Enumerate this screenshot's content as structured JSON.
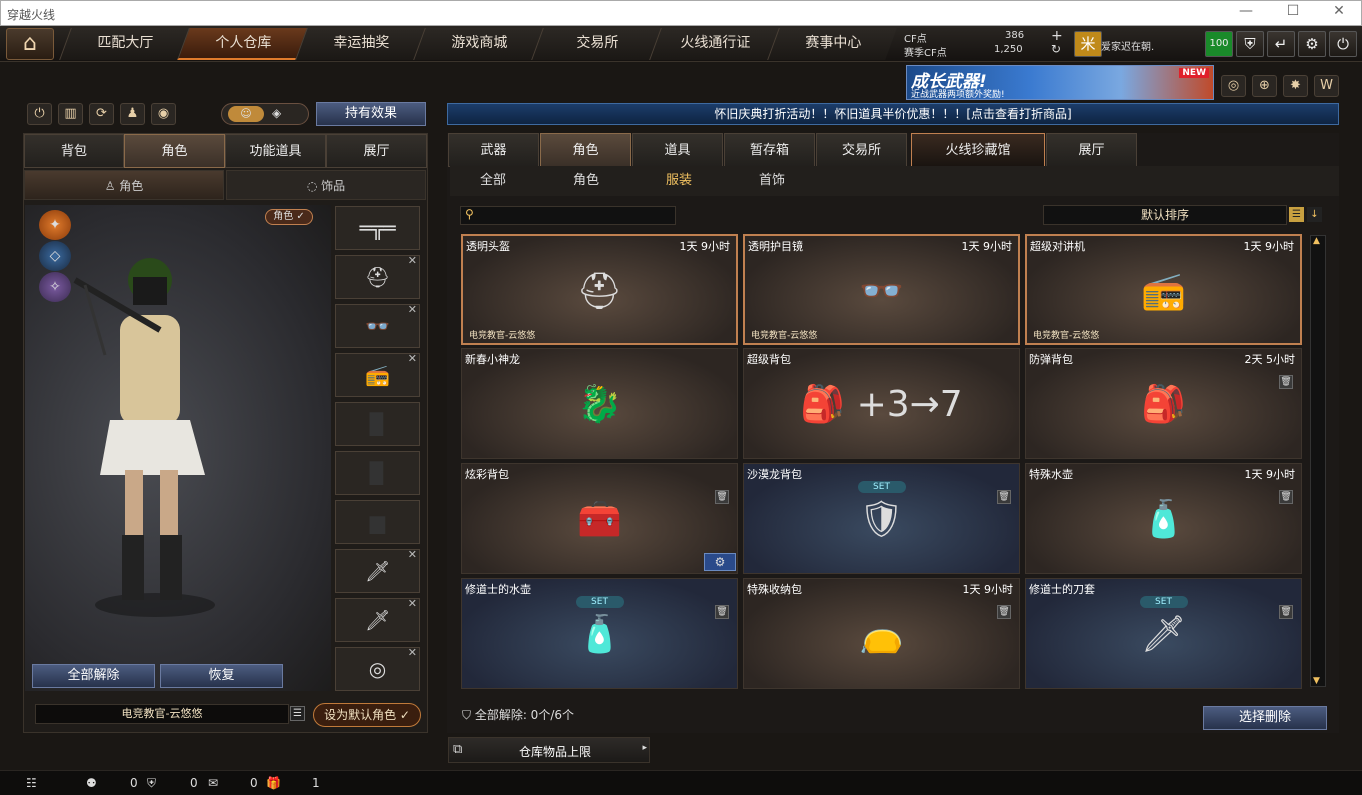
{
  "window": {
    "title": "穿越火线",
    "minimize": "—",
    "maximize": "☐",
    "close": "✕"
  },
  "nav": {
    "tabs": [
      "匹配大厅",
      "个人仓库",
      "幸运抽奖",
      "游戏商城",
      "交易所",
      "火线通行证",
      "赛事中心"
    ],
    "active": 1
  },
  "currency": {
    "cf_label": "CF点",
    "cf_value": "386",
    "match_label": "赛季CF点",
    "match_value": "1,250",
    "player": "爱家迟在朝.",
    "badge": "100",
    "icon_char": "米"
  },
  "banner": {
    "title": "成长武器!",
    "subtitle": "近战武器两项额外奖励!",
    "tag": "NEW"
  },
  "notice": "怀旧庆典打折活动！！怀旧道具半价优惠！！！[点击查看打折商品]",
  "left": {
    "effect_button": "持有效果",
    "tabs": [
      "背包",
      "角色",
      "功能道具",
      "展厅"
    ],
    "subtabs": [
      "角色",
      "饰品"
    ],
    "char_tag": "角色 ✓",
    "unequip_all": "全部解除",
    "restore": "恢复",
    "char_name": "电竞教官-云悠悠",
    "set_default": "设为默认角色 ✓"
  },
  "right": {
    "tabs": [
      "武器",
      "角色",
      "道具",
      "暂存箱",
      "交易所",
      "火线珍藏馆",
      "展厅"
    ],
    "subtabs": [
      "全部",
      "角色",
      "服装",
      "首饰"
    ],
    "sort": "默认排序",
    "unequip_status": "全部解除: 0个/6个",
    "select_delete": "选择删除",
    "storage_limit": "仓库物品上限"
  },
  "items": [
    {
      "name": "透明头盔",
      "time": "1天 9小时",
      "source": "电竞教官-云悠悠",
      "icon": "⛑",
      "selected": true
    },
    {
      "name": "透明护目镜",
      "time": "1天 9小时",
      "source": "电竞教官-云悠悠",
      "icon": "👓",
      "selected": true
    },
    {
      "name": "超级对讲机",
      "time": "1天 9小时",
      "source": "电竞教官-云悠悠",
      "icon": "📻",
      "selected": true
    },
    {
      "name": "新春小神龙",
      "time": "",
      "source": "",
      "icon": "🐉"
    },
    {
      "name": "超级背包",
      "time": "",
      "source": "",
      "icon": "🎒 +3→7"
    },
    {
      "name": "防弹背包",
      "time": "2天 5小时",
      "source": "",
      "icon": "🎒",
      "trash": true
    },
    {
      "name": "炫彩背包",
      "time": "",
      "source": "",
      "icon": "🧰",
      "trash": true,
      "gear": true
    },
    {
      "name": "沙漠龙背包",
      "time": "",
      "source": "",
      "icon": "🛡",
      "trash": true,
      "set": "SET",
      "blue": true
    },
    {
      "name": "特殊水壶",
      "time": "1天 9小时",
      "source": "",
      "icon": "🧴",
      "trash": true
    },
    {
      "name": "修道士的水壶",
      "time": "",
      "source": "",
      "icon": "🧴",
      "trash": true,
      "set": "SET",
      "blue": true
    },
    {
      "name": "特殊收纳包",
      "time": "1天 9小时",
      "source": "",
      "icon": "👝",
      "trash": true
    },
    {
      "name": "修道士的刀套",
      "time": "",
      "source": "",
      "icon": "🗡",
      "trash": true,
      "set": "SET",
      "blue": true
    }
  ],
  "bottom": {
    "a": "0",
    "b": "0",
    "c": "0",
    "d": "1"
  }
}
